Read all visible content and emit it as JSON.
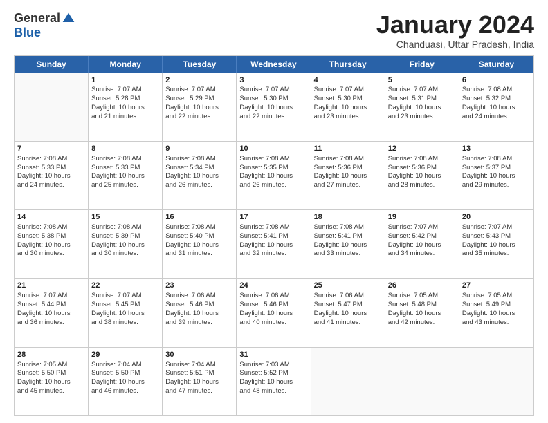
{
  "logo": {
    "general": "General",
    "blue": "Blue"
  },
  "title": "January 2024",
  "subtitle": "Chanduasi, Uttar Pradesh, India",
  "days": [
    "Sunday",
    "Monday",
    "Tuesday",
    "Wednesday",
    "Thursday",
    "Friday",
    "Saturday"
  ],
  "rows": [
    [
      {
        "num": "",
        "lines": []
      },
      {
        "num": "1",
        "lines": [
          "Sunrise: 7:07 AM",
          "Sunset: 5:28 PM",
          "Daylight: 10 hours",
          "and 21 minutes."
        ]
      },
      {
        "num": "2",
        "lines": [
          "Sunrise: 7:07 AM",
          "Sunset: 5:29 PM",
          "Daylight: 10 hours",
          "and 22 minutes."
        ]
      },
      {
        "num": "3",
        "lines": [
          "Sunrise: 7:07 AM",
          "Sunset: 5:30 PM",
          "Daylight: 10 hours",
          "and 22 minutes."
        ]
      },
      {
        "num": "4",
        "lines": [
          "Sunrise: 7:07 AM",
          "Sunset: 5:30 PM",
          "Daylight: 10 hours",
          "and 23 minutes."
        ]
      },
      {
        "num": "5",
        "lines": [
          "Sunrise: 7:07 AM",
          "Sunset: 5:31 PM",
          "Daylight: 10 hours",
          "and 23 minutes."
        ]
      },
      {
        "num": "6",
        "lines": [
          "Sunrise: 7:08 AM",
          "Sunset: 5:32 PM",
          "Daylight: 10 hours",
          "and 24 minutes."
        ]
      }
    ],
    [
      {
        "num": "7",
        "lines": [
          "Sunrise: 7:08 AM",
          "Sunset: 5:33 PM",
          "Daylight: 10 hours",
          "and 24 minutes."
        ]
      },
      {
        "num": "8",
        "lines": [
          "Sunrise: 7:08 AM",
          "Sunset: 5:33 PM",
          "Daylight: 10 hours",
          "and 25 minutes."
        ]
      },
      {
        "num": "9",
        "lines": [
          "Sunrise: 7:08 AM",
          "Sunset: 5:34 PM",
          "Daylight: 10 hours",
          "and 26 minutes."
        ]
      },
      {
        "num": "10",
        "lines": [
          "Sunrise: 7:08 AM",
          "Sunset: 5:35 PM",
          "Daylight: 10 hours",
          "and 26 minutes."
        ]
      },
      {
        "num": "11",
        "lines": [
          "Sunrise: 7:08 AM",
          "Sunset: 5:36 PM",
          "Daylight: 10 hours",
          "and 27 minutes."
        ]
      },
      {
        "num": "12",
        "lines": [
          "Sunrise: 7:08 AM",
          "Sunset: 5:36 PM",
          "Daylight: 10 hours",
          "and 28 minutes."
        ]
      },
      {
        "num": "13",
        "lines": [
          "Sunrise: 7:08 AM",
          "Sunset: 5:37 PM",
          "Daylight: 10 hours",
          "and 29 minutes."
        ]
      }
    ],
    [
      {
        "num": "14",
        "lines": [
          "Sunrise: 7:08 AM",
          "Sunset: 5:38 PM",
          "Daylight: 10 hours",
          "and 30 minutes."
        ]
      },
      {
        "num": "15",
        "lines": [
          "Sunrise: 7:08 AM",
          "Sunset: 5:39 PM",
          "Daylight: 10 hours",
          "and 30 minutes."
        ]
      },
      {
        "num": "16",
        "lines": [
          "Sunrise: 7:08 AM",
          "Sunset: 5:40 PM",
          "Daylight: 10 hours",
          "and 31 minutes."
        ]
      },
      {
        "num": "17",
        "lines": [
          "Sunrise: 7:08 AM",
          "Sunset: 5:41 PM",
          "Daylight: 10 hours",
          "and 32 minutes."
        ]
      },
      {
        "num": "18",
        "lines": [
          "Sunrise: 7:08 AM",
          "Sunset: 5:41 PM",
          "Daylight: 10 hours",
          "and 33 minutes."
        ]
      },
      {
        "num": "19",
        "lines": [
          "Sunrise: 7:07 AM",
          "Sunset: 5:42 PM",
          "Daylight: 10 hours",
          "and 34 minutes."
        ]
      },
      {
        "num": "20",
        "lines": [
          "Sunrise: 7:07 AM",
          "Sunset: 5:43 PM",
          "Daylight: 10 hours",
          "and 35 minutes."
        ]
      }
    ],
    [
      {
        "num": "21",
        "lines": [
          "Sunrise: 7:07 AM",
          "Sunset: 5:44 PM",
          "Daylight: 10 hours",
          "and 36 minutes."
        ]
      },
      {
        "num": "22",
        "lines": [
          "Sunrise: 7:07 AM",
          "Sunset: 5:45 PM",
          "Daylight: 10 hours",
          "and 38 minutes."
        ]
      },
      {
        "num": "23",
        "lines": [
          "Sunrise: 7:06 AM",
          "Sunset: 5:46 PM",
          "Daylight: 10 hours",
          "and 39 minutes."
        ]
      },
      {
        "num": "24",
        "lines": [
          "Sunrise: 7:06 AM",
          "Sunset: 5:46 PM",
          "Daylight: 10 hours",
          "and 40 minutes."
        ]
      },
      {
        "num": "25",
        "lines": [
          "Sunrise: 7:06 AM",
          "Sunset: 5:47 PM",
          "Daylight: 10 hours",
          "and 41 minutes."
        ]
      },
      {
        "num": "26",
        "lines": [
          "Sunrise: 7:05 AM",
          "Sunset: 5:48 PM",
          "Daylight: 10 hours",
          "and 42 minutes."
        ]
      },
      {
        "num": "27",
        "lines": [
          "Sunrise: 7:05 AM",
          "Sunset: 5:49 PM",
          "Daylight: 10 hours",
          "and 43 minutes."
        ]
      }
    ],
    [
      {
        "num": "28",
        "lines": [
          "Sunrise: 7:05 AM",
          "Sunset: 5:50 PM",
          "Daylight: 10 hours",
          "and 45 minutes."
        ]
      },
      {
        "num": "29",
        "lines": [
          "Sunrise: 7:04 AM",
          "Sunset: 5:50 PM",
          "Daylight: 10 hours",
          "and 46 minutes."
        ]
      },
      {
        "num": "30",
        "lines": [
          "Sunrise: 7:04 AM",
          "Sunset: 5:51 PM",
          "Daylight: 10 hours",
          "and 47 minutes."
        ]
      },
      {
        "num": "31",
        "lines": [
          "Sunrise: 7:03 AM",
          "Sunset: 5:52 PM",
          "Daylight: 10 hours",
          "and 48 minutes."
        ]
      },
      {
        "num": "",
        "lines": []
      },
      {
        "num": "",
        "lines": []
      },
      {
        "num": "",
        "lines": []
      }
    ]
  ]
}
